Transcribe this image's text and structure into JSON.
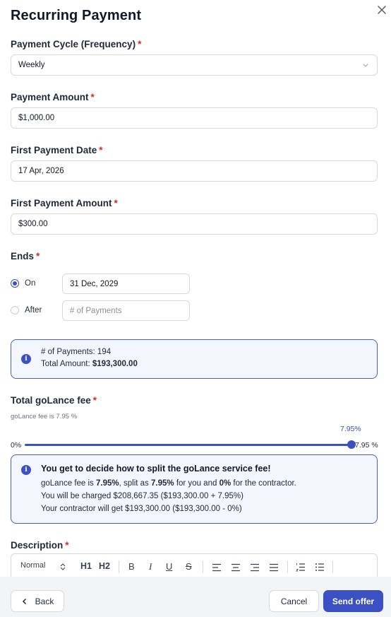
{
  "modal": {
    "title": "Recurring Payment"
  },
  "payment_cycle": {
    "label": "Payment Cycle (Frequency)",
    "value": "Weekly"
  },
  "payment_amount": {
    "label": "Payment Amount",
    "value": "$1,000.00"
  },
  "first_payment_date": {
    "label": "First Payment Date",
    "value": "17 Apr, 2026"
  },
  "first_payment_amount": {
    "label": "First Payment Amount",
    "value": "$300.00"
  },
  "ends": {
    "label": "Ends",
    "on_label": "On",
    "on_value": "31 Dec, 2029",
    "after_label": "After",
    "after_placeholder": "# of Payments",
    "selected": "On"
  },
  "summary": {
    "payments_line": "# of Payments: 194",
    "total_label": "Total Amount:",
    "total_value": "$193,300.00"
  },
  "fee": {
    "label": "Total goLance fee",
    "hint": "goLance fee is 7.95 %",
    "slider_value_label": "7.95%",
    "min_label": "0%",
    "max_label": "7.95 %",
    "slider_fraction": 1.0
  },
  "fee_info": {
    "heading": "You get to decide how to split the goLance service fee!",
    "line1_a": "goLance fee is ",
    "line1_b": "7.95%",
    "line1_c": ", split as ",
    "line1_d": "7.95%",
    "line1_e": " for you and ",
    "line1_f": "0%",
    "line1_g": " for the contractor.",
    "line2": "You will be charged $208,667.35 ($193,300.00 + 7.95%)",
    "line3": "Your contractor will get $193,300.00 ($193,300.00 - 0%)"
  },
  "description": {
    "label": "Description",
    "format_select": "Normal",
    "h1": "H1",
    "h2": "H2",
    "bold": "B",
    "italic": "I",
    "underline": "U",
    "strike": "S"
  },
  "footer": {
    "back": "Back",
    "cancel": "Cancel",
    "send": "Send offer"
  },
  "colors": {
    "accent": "#3b50c2",
    "required": "#dc2626"
  }
}
